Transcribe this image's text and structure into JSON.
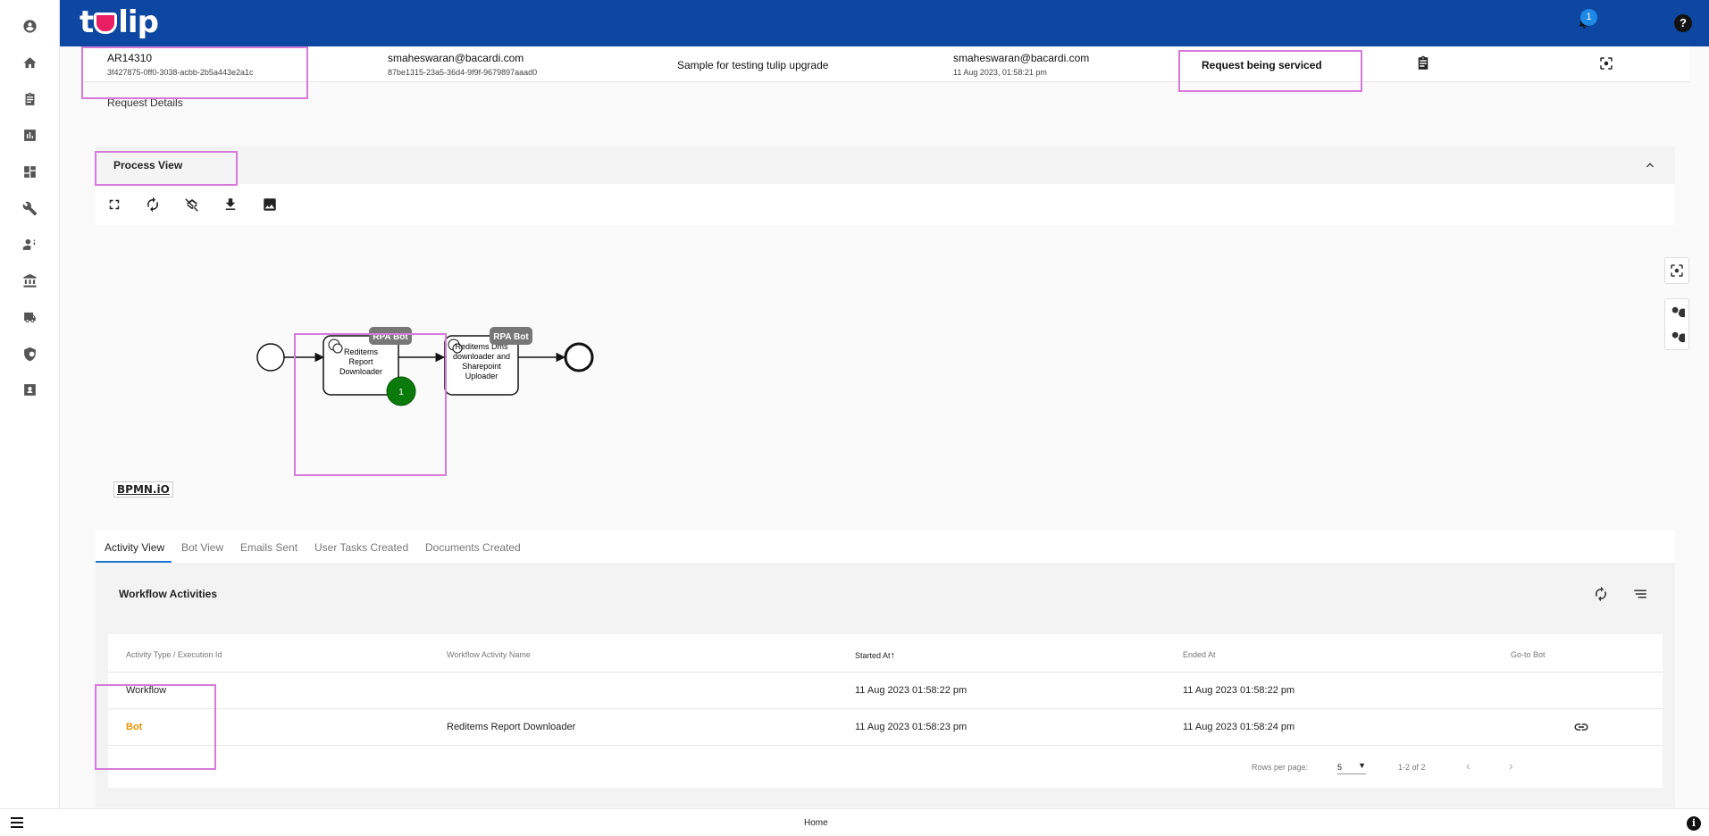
{
  "app": {
    "logo_text": "tulip",
    "notification_count": "1"
  },
  "request": {
    "id": "AR14310",
    "uuid": "3f427875-0ff0-3038-acbb-2b5a443e2a1c",
    "requester_email": "smaheswaran@bacardi.com",
    "requester_uuid": "87be1315-23a5-36d4-9f9f-9679897aaad0",
    "description": "Sample for testing tulip upgrade",
    "owner_email": "smaheswaran@bacardi.com",
    "owner_time": "11 Aug 2023, 01:58:21 pm",
    "status": "Request being serviced"
  },
  "sections": {
    "request_details": "Request Details",
    "process_view": "Process View"
  },
  "process": {
    "task1": [
      "Reditems",
      "Report",
      "Downloader"
    ],
    "task2": [
      "Reditems Dms",
      "downloader and",
      "Sharepoint",
      "Uploader"
    ],
    "badge": "RPA Bot",
    "token_count": "1",
    "bpmn_logo": "BPMN.iO"
  },
  "tabs": [
    "Activity View",
    "Bot View",
    "Emails Sent",
    "User Tasks Created",
    "Documents Created"
  ],
  "activities": {
    "title": "Workflow Activities",
    "columns": [
      "Activity Type / Execution Id",
      "Workflow Activity Name",
      "Started At",
      "Ended At",
      "Go-to Bot"
    ],
    "rows": [
      {
        "type": "Workflow",
        "name": "",
        "started": "11 Aug 2023 01:58:22 pm",
        "ended": "11 Aug 2023 01:58:22 pm"
      },
      {
        "type": "Bot",
        "name": "Reditems Report Downloader",
        "started": "11 Aug 2023 01:58:23 pm",
        "ended": "11 Aug 2023 01:58:24 pm"
      }
    ],
    "rows_per_page_label": "Rows per page:",
    "rows_per_page": "5",
    "range": "1-2 of 2"
  },
  "footer": {
    "home": "Home"
  },
  "colors": {
    "header": "#0d47a1",
    "accent": "#1976d2",
    "highlight": "#d67ad9",
    "bot": "#e69500"
  }
}
